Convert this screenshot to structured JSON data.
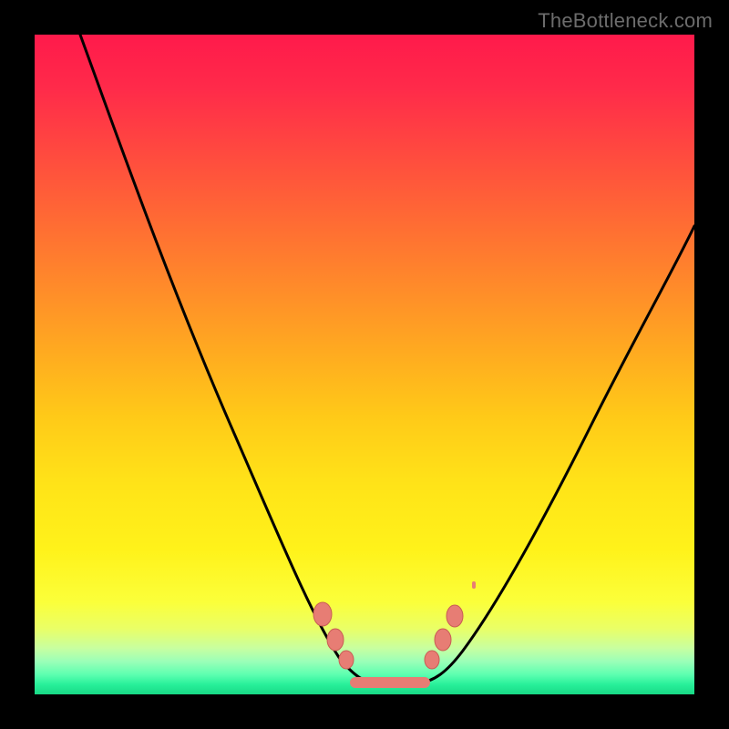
{
  "watermark": {
    "text": "TheBottleneck.com"
  },
  "colors": {
    "bead": "#e77d74",
    "bead_stroke": "#c95d54",
    "curve": "#000000",
    "frame": "#000000"
  },
  "chart_data": {
    "type": "line",
    "title": "",
    "xlabel": "",
    "ylabel": "",
    "xlim": [
      0,
      100
    ],
    "ylim": [
      0,
      100
    ],
    "grid": false,
    "legend": false,
    "note": "Values estimated from pixel positions; y is percentage where 100 = top of the colored area (red) and 0 = bottom (green).",
    "series": [
      {
        "name": "left-curve",
        "x": [
          7,
          13,
          19,
          25,
          31,
          37,
          41,
          44,
          47,
          50,
          53
        ],
        "values": [
          100,
          86,
          71,
          56,
          42,
          28,
          18,
          11,
          6,
          3,
          2
        ]
      },
      {
        "name": "right-curve",
        "x": [
          53,
          57,
          61,
          66,
          72,
          78,
          84,
          90,
          96,
          100
        ],
        "values": [
          2,
          3,
          6,
          12,
          22,
          34,
          46,
          57,
          66,
          72
        ]
      }
    ],
    "flat_bottom": {
      "x_start": 48,
      "x_end": 59,
      "y": 2
    },
    "beads_left": [
      {
        "x": 43.5,
        "y": 12,
        "r": 1.3
      },
      {
        "x": 45.5,
        "y": 8.5,
        "r": 1.2
      },
      {
        "x": 47.0,
        "y": 6.0,
        "r": 1.1
      }
    ],
    "beads_right": [
      {
        "x": 60.0,
        "y": 6.0,
        "r": 1.1
      },
      {
        "x": 61.5,
        "y": 8.5,
        "r": 1.2
      },
      {
        "x": 63.5,
        "y": 12,
        "r": 1.2
      }
    ],
    "tiny_speck_right": {
      "x": 66.5,
      "y": 17
    }
  }
}
